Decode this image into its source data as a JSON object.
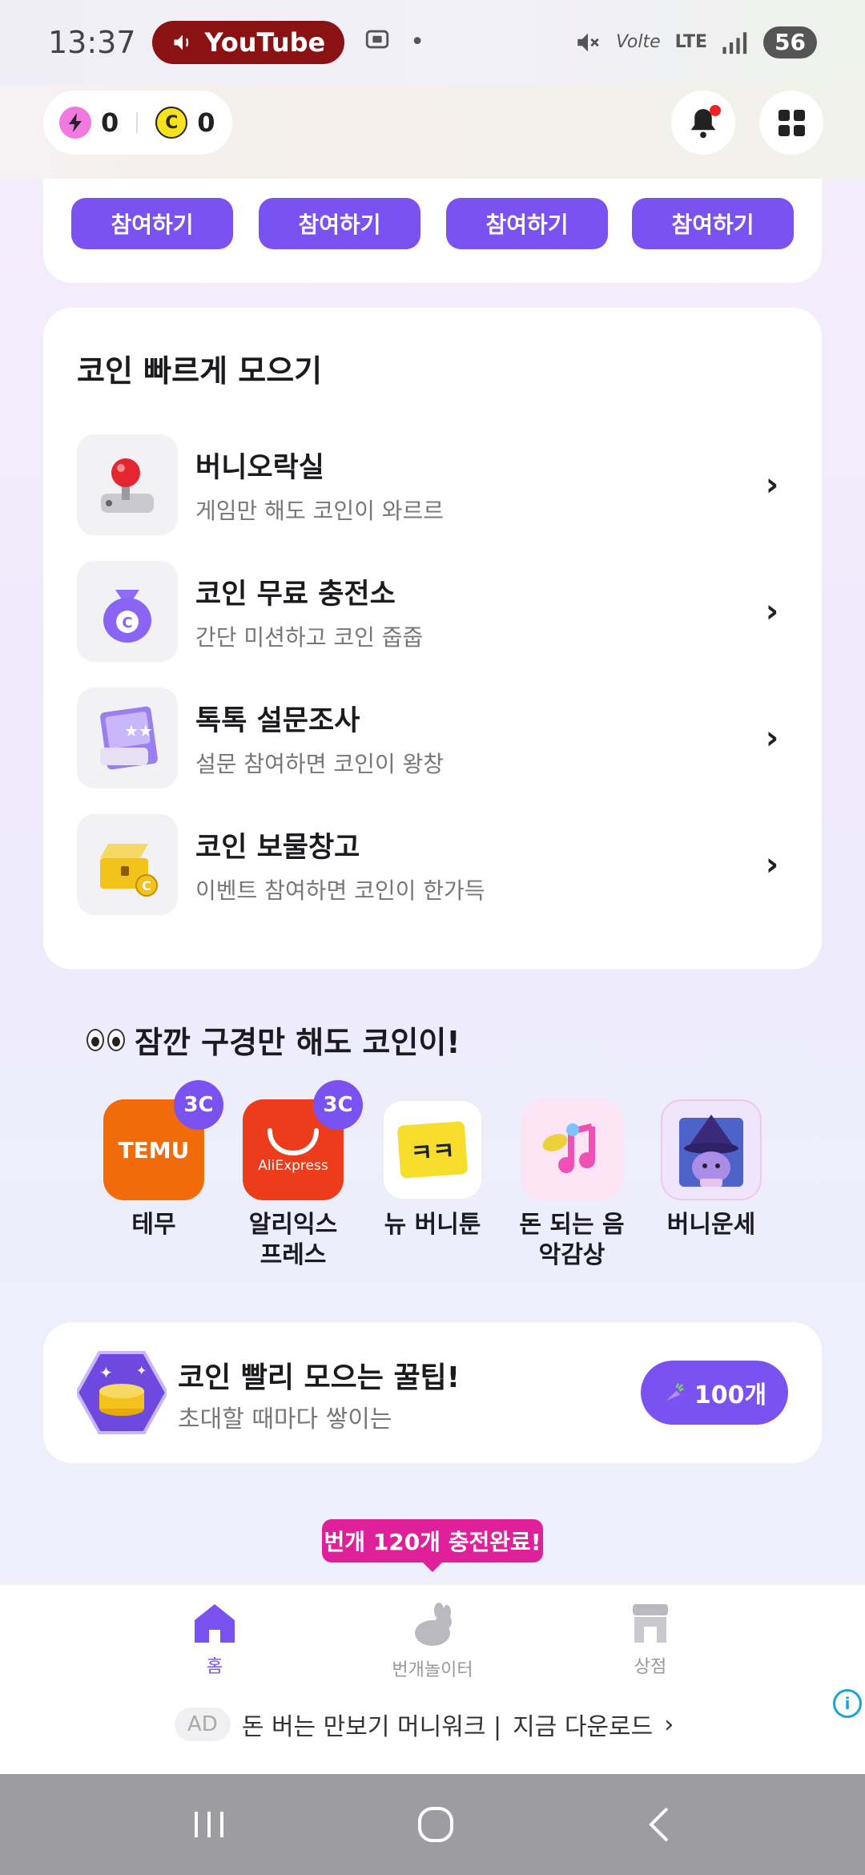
{
  "status_bar": {
    "time": "13:37",
    "media_app": "YouTube",
    "network": "LTE",
    "battery": "56"
  },
  "wallet": {
    "bolt_count": "0",
    "coin_symbol": "C",
    "coin_count": "0"
  },
  "top_card": {
    "buttons": [
      "참여하기",
      "참여하기",
      "참여하기",
      "참여하기"
    ]
  },
  "coins_section": {
    "title": "코인 빠르게 모으기",
    "items": [
      {
        "title": "버니오락실",
        "subtitle": "게임만 해도 코인이 와르르"
      },
      {
        "title": "코인 무료 충전소",
        "subtitle": "간단 미션하고 코인 줍줍"
      },
      {
        "title": "톡톡 설문조사",
        "subtitle": "설문 참여하면 코인이 왕창"
      },
      {
        "title": "코인 보물창고",
        "subtitle": "이벤트 참여하면 코인이 한가득"
      }
    ]
  },
  "browse_section": {
    "title": "잠깐 구경만 해도 코인이!",
    "apps": [
      {
        "label": "테무",
        "badge": "3C",
        "icon_text": "TEMU"
      },
      {
        "label": "알리익스프레스",
        "badge": "3C",
        "icon_text": "AliExpress"
      },
      {
        "label": "뉴 버니툰",
        "badge": "",
        "icon_text": "ㅋㅋ"
      },
      {
        "label": "돈 되는 음악감상",
        "badge": "",
        "icon_text": ""
      },
      {
        "label": "버니운세",
        "badge": "",
        "icon_text": ""
      }
    ]
  },
  "tip_card": {
    "title": "코인 빨리 모으는 꿀팁!",
    "subtitle": "초대할 때마다 쌓이는",
    "button": "100개"
  },
  "tooltip": "번개 120개 충전완료!",
  "bottom_nav": {
    "items": [
      {
        "label": "홈"
      },
      {
        "label": "번개놀이터"
      },
      {
        "label": "상점"
      }
    ]
  },
  "ad": {
    "tag": "AD",
    "text": "돈 버는 만보기 머니워크 |",
    "cta": "지금 다운로드"
  },
  "colors": {
    "accent": "#7b52f2",
    "tooltip": "#e01f9a"
  }
}
